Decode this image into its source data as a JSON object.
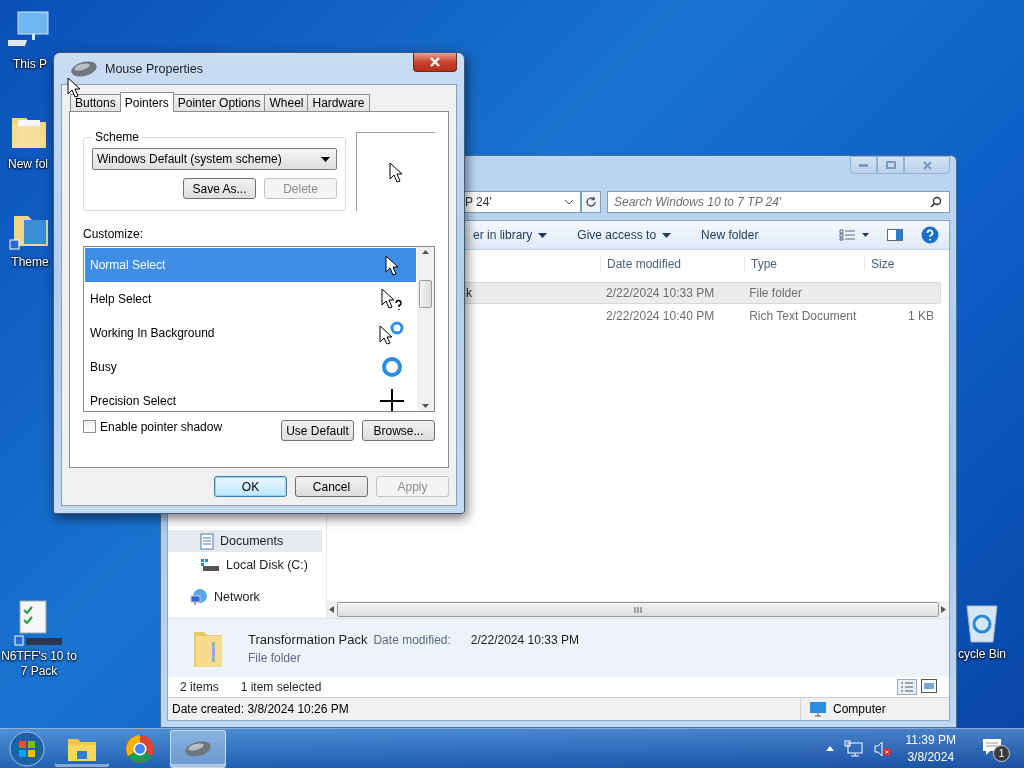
{
  "desktop_icons": [
    {
      "label": "This P",
      "kind": "computer"
    },
    {
      "label": "New fol",
      "kind": "folder"
    },
    {
      "label": "Theme",
      "kind": "theme"
    },
    {
      "label": "N6TFF's 10 to 7 Pack",
      "kind": "checklist"
    },
    {
      "label": "cycle Bin",
      "kind": "recycle"
    }
  ],
  "explorer": {
    "address_fragment": "P 24'",
    "search_placeholder": "Search Windows 10 to 7 TP 24'",
    "toolbar": [
      {
        "label": "er in library",
        "dropdown": true
      },
      {
        "label": "Give access to",
        "dropdown": true
      },
      {
        "label": "New folder",
        "dropdown": false
      }
    ],
    "columns": [
      "Date modified",
      "Type",
      "Size"
    ],
    "rows": [
      {
        "name": "k",
        "date": "2/22/2024 10:33 PM",
        "type": "File folder",
        "selected": true
      },
      {
        "date": "2/22/2024 10:40 PM",
        "type": "Rich Text Document",
        "size": "1 KB",
        "selected": false
      }
    ],
    "nav": [
      {
        "label": "Documents",
        "kind": "documents",
        "selected": true
      },
      {
        "label": "Local Disk (C:)",
        "kind": "drive",
        "selected": false
      },
      {
        "label": "Network",
        "kind": "network",
        "selected": false
      }
    ],
    "details": {
      "name": "Transformation Pack",
      "meta_label": "Date modified:",
      "meta_value": "2/22/2024 10:33 PM",
      "type": "File folder"
    },
    "status": {
      "count": "2 items",
      "selection": "1 item selected"
    },
    "status_bar": {
      "date_created": "Date created: 3/8/2024 10:26 PM",
      "location": "Computer"
    }
  },
  "dialog": {
    "title": "Mouse Properties",
    "tabs": [
      {
        "label": "Buttons",
        "selected": false
      },
      {
        "label": "Pointers",
        "selected": true
      },
      {
        "label": "Pointer Options",
        "selected": false
      },
      {
        "label": "Wheel",
        "selected": false
      },
      {
        "label": "Hardware",
        "selected": false
      }
    ],
    "scheme_label": "Scheme",
    "scheme_value": "Windows Default (system scheme)",
    "scheme_buttons": [
      {
        "label": "Save As...",
        "disabled": false
      },
      {
        "label": "Delete",
        "disabled": true
      }
    ],
    "customize_label": "Customize:",
    "cursors": [
      {
        "name": "Normal Select",
        "kind": "arrow",
        "selected": true
      },
      {
        "name": "Help Select",
        "kind": "help",
        "selected": false
      },
      {
        "name": "Working In Background",
        "kind": "working",
        "selected": false
      },
      {
        "name": "Busy",
        "kind": "busy",
        "selected": false
      },
      {
        "name": "Precision Select",
        "kind": "cross",
        "selected": false
      }
    ],
    "shadow": {
      "label": "Enable pointer shadow",
      "checked": false
    },
    "list_buttons": [
      {
        "label": "Use Default",
        "disabled": false
      },
      {
        "label": "Browse...",
        "disabled": false
      }
    ],
    "footer_buttons": [
      {
        "label": "OK",
        "default": true,
        "disabled": false
      },
      {
        "label": "Cancel",
        "default": false,
        "disabled": false
      },
      {
        "label": "Apply",
        "default": false,
        "disabled": true
      }
    ]
  },
  "taskbar": {
    "apps": [
      {
        "kind": "explorer",
        "running": true,
        "active": false
      },
      {
        "kind": "chrome",
        "running": false,
        "active": false
      },
      {
        "kind": "mouse",
        "running": true,
        "active": true
      }
    ],
    "clock": {
      "time": "11:39 PM",
      "date": "3/8/2024"
    },
    "notification_count": "1"
  }
}
